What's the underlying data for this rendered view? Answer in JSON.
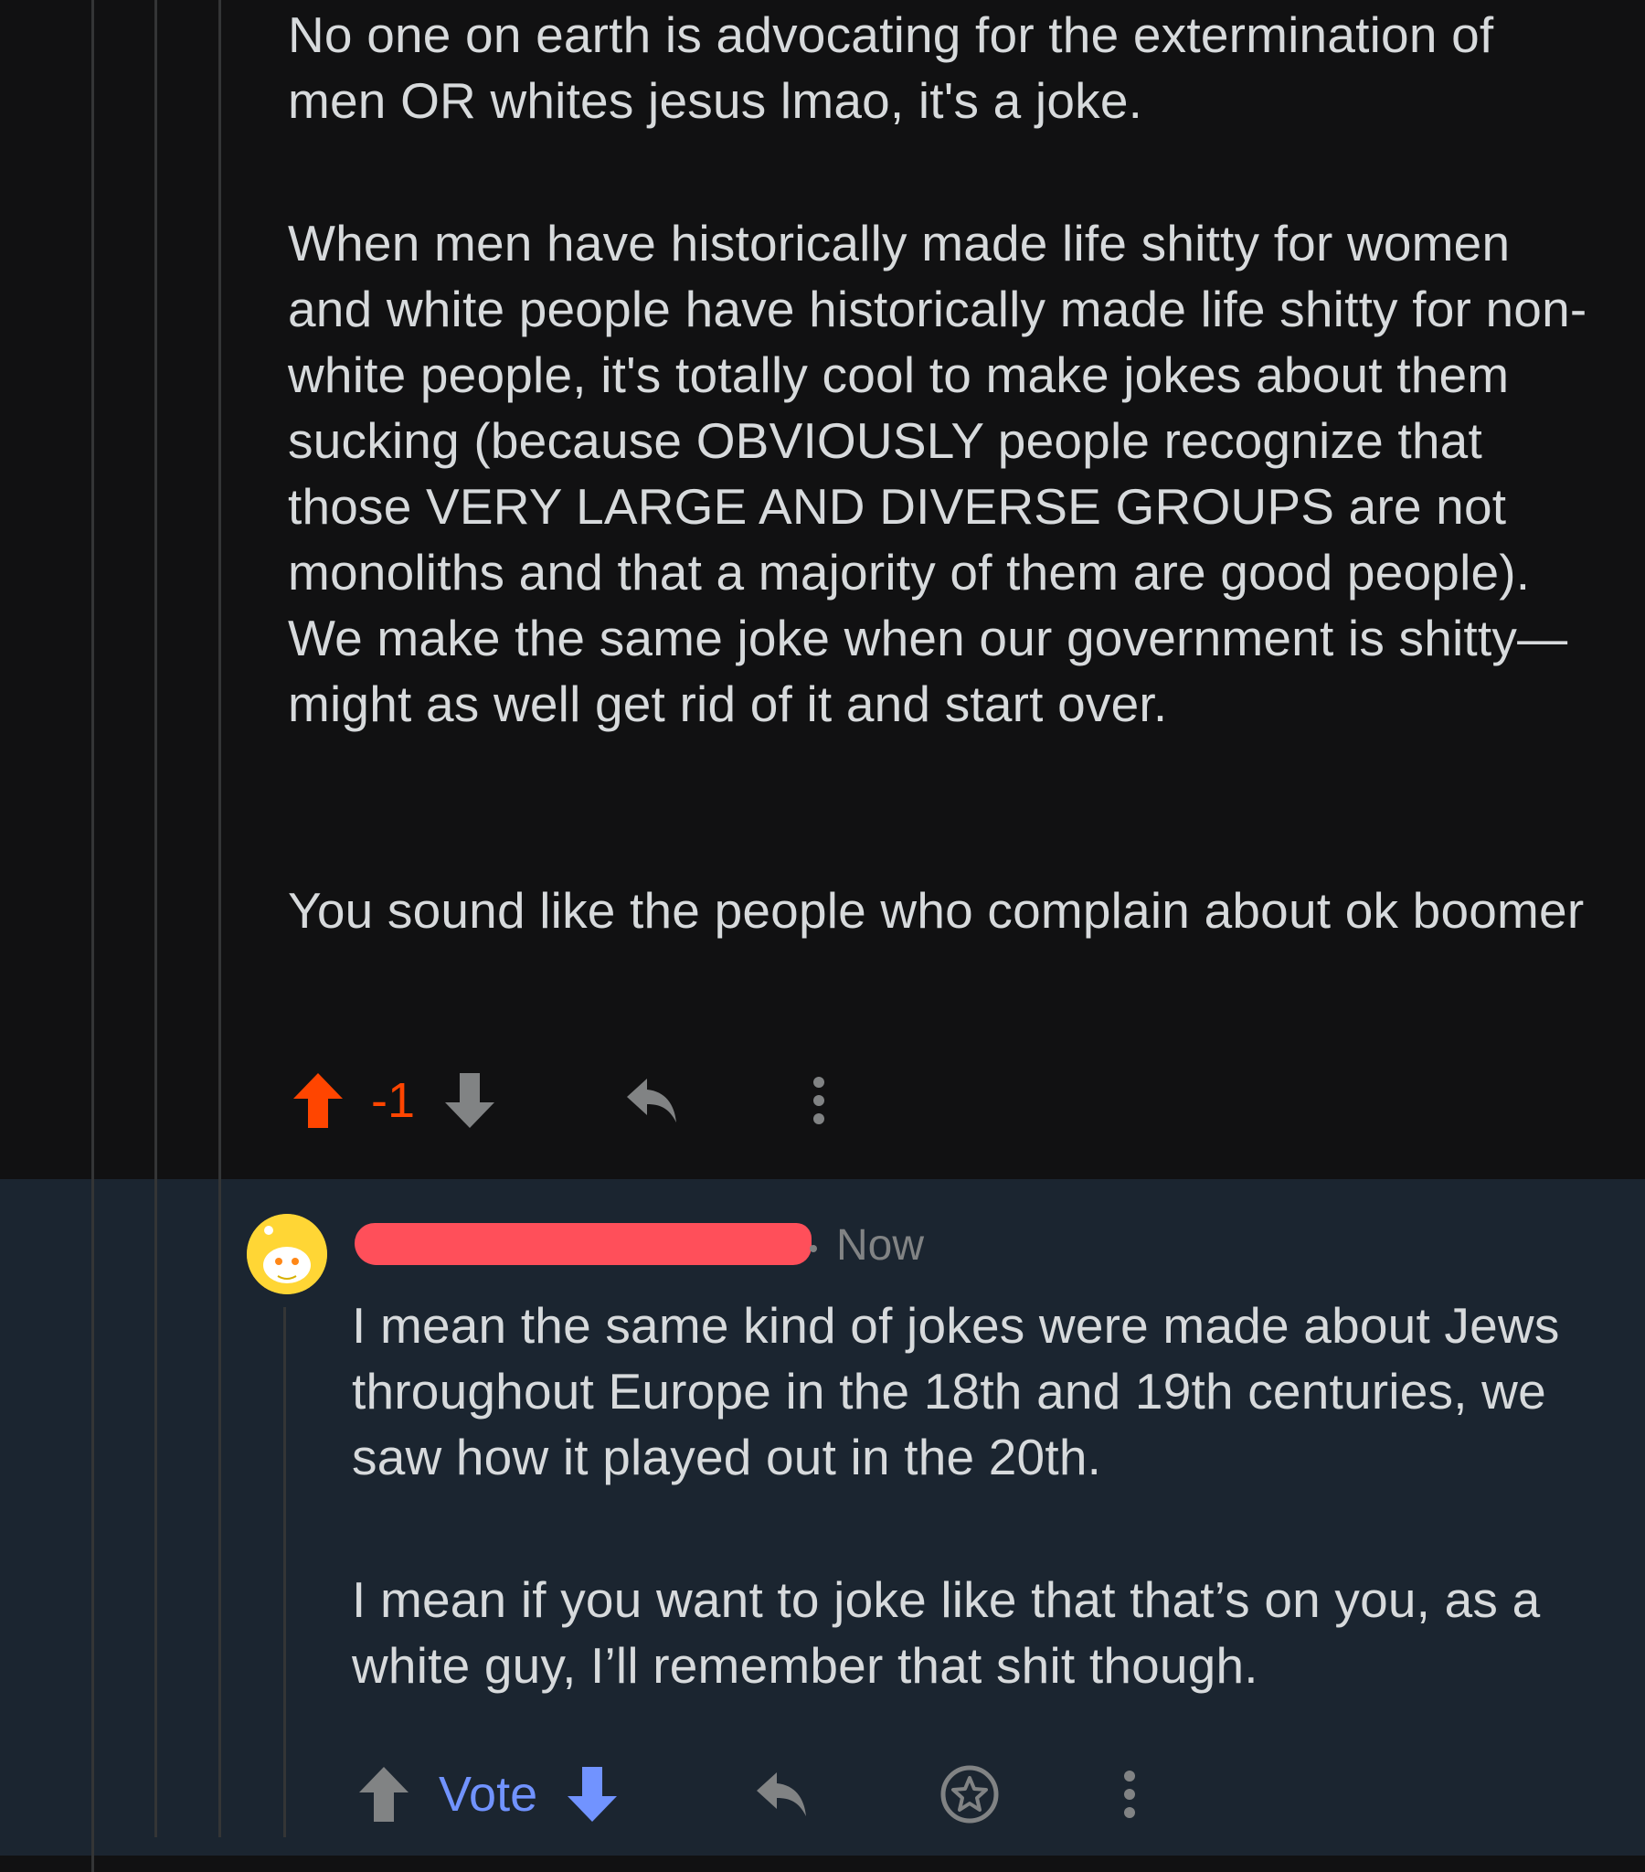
{
  "parent_comment": {
    "paragraphs": [
      "No one on earth is advocating for the extermination of men OR whites jesus lmao, it's a joke.",
      "When men have historically made life shitty for women and white people have historically made life shitty for non-white people, it's totally cool to make jokes about them sucking (because OBVIOUSLY people recognize that those VERY LARGE AND DIVERSE GROUPS are not monoliths and that a majority of them are good people). We make the same joke when our government is shitty—might as well get rid of it and start over.",
      "You sound like the people who complain about ok boomer"
    ],
    "score": "-1",
    "upvoted": true
  },
  "reply_comment": {
    "username": "",
    "timestamp": "Now",
    "paragraphs": [
      "I mean the same kind of jokes were made about Jews throughout Europe in the 18th and 19th centuries, we saw how it played out in the 20th.",
      "I mean if you want to joke like that that’s on you, as a white guy, I’ll remember that shit though."
    ],
    "vote_label": "Vote"
  },
  "colors": {
    "upvote_active": "#ff4500",
    "vote_blue": "#7193ff",
    "icon_gray": "#818384",
    "text": "#d7dadc",
    "redaction": "#ff4f5a",
    "avatar": "#ffd635"
  },
  "icons": {
    "upvote": "arrow-up-icon",
    "downvote": "arrow-down-icon",
    "reply": "reply-icon",
    "more": "more-vertical-icon",
    "award": "award-icon"
  }
}
